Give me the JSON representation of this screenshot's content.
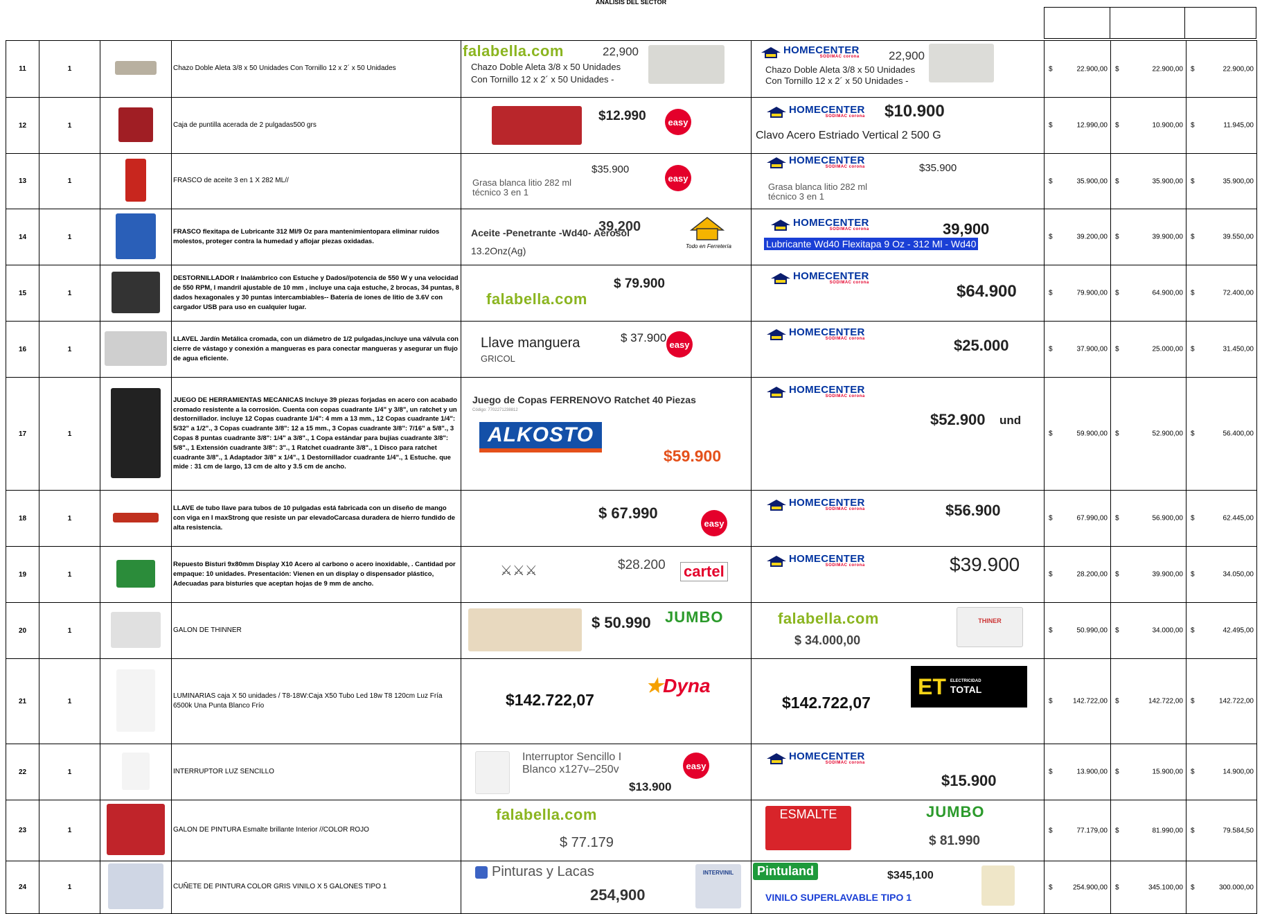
{
  "header": {
    "title": "ANÁLISIS DEL SECTOR"
  },
  "colors": {
    "homecenter_blue": "#0033a0",
    "falabella_green": "#8bb520",
    "easy_red": "#e4002b",
    "jumbo_green": "#2b9a2b",
    "alkosto_blue": "#1450a8"
  },
  "brands": {
    "falabella": "falabella.com",
    "homecenter": "HOMECENTER",
    "homecenter_sub": "SODIMAC corona",
    "easy": "easy",
    "jumbo": "JUMBO",
    "alkosto": "ALKOSTO",
    "dyna": "Dyna",
    "elec_big": "ET",
    "elec_small": "ELECTRICIDAD",
    "elec_total": "TOTAL",
    "cartel": "cartel",
    "pintuland": "Pintuland",
    "pinturas_lacas": "Pinturas y Lacas",
    "casa_ferreteria": "Todo en Ferretería"
  },
  "rows": [
    {
      "num": "11",
      "qty": "1",
      "desc": "Chazo Doble Aleta 3/8 x 50 Unidades Con Tornillo 12 x 2´ x 50 Unidades",
      "q1": {
        "price": "22,900",
        "text1": "Chazo Doble Aleta 3/8 x 50 Unidades",
        "text2": "Con Tornillo 12 x 2´ x 50 Unidades -"
      },
      "q2": {
        "price": "22,900",
        "text1": "Chazo Doble Aleta 3/8 x 50 Unidades",
        "text2": "Con Tornillo 12 x 2´ x 50 Unidades -"
      },
      "p1": "22.900,00",
      "p2": "22.900,00",
      "p3": "22.900,00"
    },
    {
      "num": "12",
      "qty": "1",
      "desc": "Caja de puntilla acerada de 2 pulgadas500 grs",
      "q1": {
        "price": "$12.990"
      },
      "q2": {
        "price": "$10.900",
        "text1": "Clavo Acero Estriado Vertical 2 500 G"
      },
      "p1": "12.990,00",
      "p2": "10.900,00",
      "p3": "11.945,00"
    },
    {
      "num": "13",
      "qty": "1",
      "desc": "FRASCO de aceite 3 en 1 X 282 ML//",
      "q1": {
        "price": "$35.900",
        "text1": "Grasa blanca litio 282 ml",
        "text2": "técnico 3 en 1"
      },
      "q2": {
        "price": "$35.900",
        "text1": "Grasa blanca litio 282 ml",
        "text2": "técnico 3 en 1"
      },
      "p1": "35.900,00",
      "p2": "35.900,00",
      "p3": "35.900,00"
    },
    {
      "num": "14",
      "qty": "1",
      "desc": "FRASCO flexitapa de Lubricante 312 Ml/9 Oz para mantenimientopara eliminar ruidos molestos, proteger contra la humedad y aflojar piezas oxidadas.",
      "q1": {
        "price": "39,200",
        "text1": "Aceite -Penetrante -Wd40- Aerosol",
        "text2": "13.2Onz(Ag)"
      },
      "q2": {
        "price": "39,900",
        "text1": "Lubricante Wd40 Flexitapa 9 Oz - 312 Ml - Wd40"
      },
      "p1": "39.200,00",
      "p2": "39.900,00",
      "p3": "39.550,00"
    },
    {
      "num": "15",
      "qty": "1",
      "desc": "DESTORNILLADOR r Inalámbrico con Estuche y Dados//potencia de 550 W y una velocidad de 550 RPM, l mandril ajustable de 10 mm , incluye una caja estuche, 2 brocas, 34 puntas, 8 dados hexagonales y 30 puntas intercambiables-- Batería de iones de litio de 3.6V con cargador USB para uso en cualquier lugar.",
      "q1": {
        "price": "$ 79.900"
      },
      "q2": {
        "price": "$64.900"
      },
      "p1": "79.900,00",
      "p2": "64.900,00",
      "p3": "72.400,00"
    },
    {
      "num": "16",
      "qty": "1",
      "desc": "LLAVEL Jardín Metálica cromada, con un diámetro de 1/2 pulgadas,incluye una válvula con cierre de vástago y conexión a mangueras es  para conectar mangueras y asegurar un flujo de agua eficiente.",
      "q1": {
        "price": "$ 37.900",
        "text1": "Llave manguera",
        "text2": "GRICOL"
      },
      "q2": {
        "price": "$25.000"
      },
      "p1": "37.900,00",
      "p2": "25.000,00",
      "p3": "31.450,00"
    },
    {
      "num": "17",
      "qty": "1",
      "desc": "JUEGO DE HERRAMIENTAS MECANICAS Incluye 39 piezas forjadas en acero con acabado cromado resistente a la corrosión. Cuenta con copas cuadrante 1/4\" y 3/8\", un ratchet y un destornillador. incluye 12 Copas cuadrante 1/4\": 4 mm a 13 mm., 12 Copas cuadrante 1/4\": 5/32\" a 1/2\"., 3 Copas cuadrante 3/8\": 12 a 15 mm., 3 Copas cuadrante 3/8\": 7/16\" a 5/8\"., 3 Copas 8 puntas cuadrante 3/8\": 1/4\" a 3/8\"., 1 Copa estándar para bujías cuadrante 3/8\": 5/8\"., 1 Extensión cuadrante 3/8\": 3\"., 1 Ratchet cuadrante 3/8\"., 1 Disco para ratchet cuadrante 3/8\"., 1 Adaptador 3/8\" x 1/4\"., 1 Destornillador cuadrante 1/4\"., 1 Estuche.  que mide : 31 cm de largo, 13 cm de alto y 3.5 cm de ancho.",
      "q1": {
        "price": "$59.900",
        "text1": "Juego de Copas FERRENOVO Ratchet 40 Piezas",
        "text2": "Código: 7702271238812"
      },
      "q2": {
        "price": "$52.900",
        "unit": "und"
      },
      "p1": "59.900,00",
      "p2": "52.900,00",
      "p3": "56.400,00"
    },
    {
      "num": "18",
      "qty": "1",
      "desc": "LLAVE de tubo llave para tubos de 10 pulgadas está fabricada con un diseño de mango con viga en I maxStrong que resiste un par elevadoCarcasa duradera de hierro fundido de alta resistencia.",
      "q1": {
        "price": "$ 67.990"
      },
      "q2": {
        "price": "$56.900"
      },
      "p1": "67.990,00",
      "p2": "56.900,00",
      "p3": "62.445,00"
    },
    {
      "num": "19",
      "qty": "1",
      "desc": "Repuesto Bisturi 9x80mm Display X10 Acero al carbono o acero inoxidable, . Cantidad por empaque: 10 unidades. Presentación: Vienen en un display o dispensador plástico,  Adecuadas para bisturíes que aceptan hojas de 9 mm de ancho.",
      "q1": {
        "price": "$28.200"
      },
      "q2": {
        "price": "$39.900"
      },
      "p1": "28.200,00",
      "p2": "39.900,00",
      "p3": "34.050,00"
    },
    {
      "num": "20",
      "qty": "1",
      "desc": "GALON DE THINNER",
      "q1": {
        "price": "$ 50.990"
      },
      "q2": {
        "price": "$ 34.000,00",
        "label": "THINER"
      },
      "p1": "50.990,00",
      "p2": "34.000,00",
      "p3": "42.495,00"
    },
    {
      "num": "21",
      "qty": "1",
      "desc": "LUMINARIAS caja X 50 unidades / T8-18W:Caja X50 Tubo Led 18w T8 120cm Luz Fría 6500k Una Punta Blanco Frío",
      "q1": {
        "price": "$142.722,07"
      },
      "q2": {
        "price": "$142.722,07"
      },
      "p1": "142.722,00",
      "p2": "142.722,00",
      "p3": "142.722,00"
    },
    {
      "num": "22",
      "qty": "1",
      "desc": "INTERRUPTOR LUZ SENCILLO",
      "q1": {
        "price": "$13.900",
        "text1": "Interruptor Sencillo I",
        "text2": "Blanco x127v–250v"
      },
      "q2": {
        "price": "$15.900"
      },
      "p1": "13.900,00",
      "p2": "15.900,00",
      "p3": "14.900,00"
    },
    {
      "num": "23",
      "qty": "1",
      "desc": "GALON DE PINTURA Esmalte brillante Interior //COLOR ROJO",
      "q1": {
        "price": "$ 77.179"
      },
      "q2": {
        "price": "$ 81.990",
        "label": "ESMALTE"
      },
      "p1": "77.179,00",
      "p2": "81.990,00",
      "p3": "79.584,50"
    },
    {
      "num": "24",
      "qty": "1",
      "desc": "CUÑETE DE PINTURA COLOR GRIS  VINILO X 5 GALONES TIPO 1",
      "q1": {
        "price": "254,900",
        "label": "INTERVINIL"
      },
      "q2": {
        "price": "$345,100",
        "text1": "VINILO SUPERLAVABLE TIPO 1"
      },
      "p1": "254.900,00",
      "p2": "345.100,00",
      "p3": "300.000,00"
    }
  ],
  "currency": "$"
}
